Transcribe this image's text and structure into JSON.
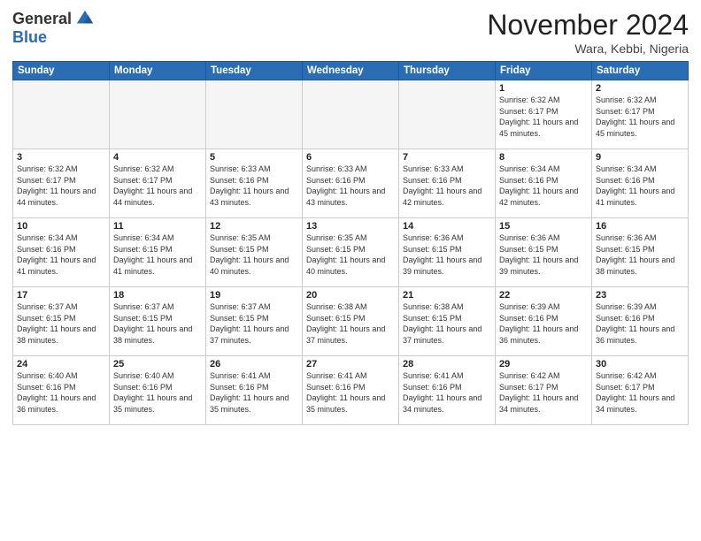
{
  "header": {
    "logo": {
      "general": "General",
      "blue": "Blue"
    },
    "title": "November 2024",
    "subtitle": "Wara, Kebbi, Nigeria"
  },
  "weekdays": [
    "Sunday",
    "Monday",
    "Tuesday",
    "Wednesday",
    "Thursday",
    "Friday",
    "Saturday"
  ],
  "weeks": [
    [
      {
        "day": "",
        "empty": true
      },
      {
        "day": "",
        "empty": true
      },
      {
        "day": "",
        "empty": true
      },
      {
        "day": "",
        "empty": true
      },
      {
        "day": "",
        "empty": true
      },
      {
        "day": "1",
        "sunrise": "Sunrise: 6:32 AM",
        "sunset": "Sunset: 6:17 PM",
        "daylight": "Daylight: 11 hours and 45 minutes."
      },
      {
        "day": "2",
        "sunrise": "Sunrise: 6:32 AM",
        "sunset": "Sunset: 6:17 PM",
        "daylight": "Daylight: 11 hours and 45 minutes."
      }
    ],
    [
      {
        "day": "3",
        "sunrise": "Sunrise: 6:32 AM",
        "sunset": "Sunset: 6:17 PM",
        "daylight": "Daylight: 11 hours and 44 minutes."
      },
      {
        "day": "4",
        "sunrise": "Sunrise: 6:32 AM",
        "sunset": "Sunset: 6:17 PM",
        "daylight": "Daylight: 11 hours and 44 minutes."
      },
      {
        "day": "5",
        "sunrise": "Sunrise: 6:33 AM",
        "sunset": "Sunset: 6:16 PM",
        "daylight": "Daylight: 11 hours and 43 minutes."
      },
      {
        "day": "6",
        "sunrise": "Sunrise: 6:33 AM",
        "sunset": "Sunset: 6:16 PM",
        "daylight": "Daylight: 11 hours and 43 minutes."
      },
      {
        "day": "7",
        "sunrise": "Sunrise: 6:33 AM",
        "sunset": "Sunset: 6:16 PM",
        "daylight": "Daylight: 11 hours and 42 minutes."
      },
      {
        "day": "8",
        "sunrise": "Sunrise: 6:34 AM",
        "sunset": "Sunset: 6:16 PM",
        "daylight": "Daylight: 11 hours and 42 minutes."
      },
      {
        "day": "9",
        "sunrise": "Sunrise: 6:34 AM",
        "sunset": "Sunset: 6:16 PM",
        "daylight": "Daylight: 11 hours and 41 minutes."
      }
    ],
    [
      {
        "day": "10",
        "sunrise": "Sunrise: 6:34 AM",
        "sunset": "Sunset: 6:16 PM",
        "daylight": "Daylight: 11 hours and 41 minutes."
      },
      {
        "day": "11",
        "sunrise": "Sunrise: 6:34 AM",
        "sunset": "Sunset: 6:15 PM",
        "daylight": "Daylight: 11 hours and 41 minutes."
      },
      {
        "day": "12",
        "sunrise": "Sunrise: 6:35 AM",
        "sunset": "Sunset: 6:15 PM",
        "daylight": "Daylight: 11 hours and 40 minutes."
      },
      {
        "day": "13",
        "sunrise": "Sunrise: 6:35 AM",
        "sunset": "Sunset: 6:15 PM",
        "daylight": "Daylight: 11 hours and 40 minutes."
      },
      {
        "day": "14",
        "sunrise": "Sunrise: 6:36 AM",
        "sunset": "Sunset: 6:15 PM",
        "daylight": "Daylight: 11 hours and 39 minutes."
      },
      {
        "day": "15",
        "sunrise": "Sunrise: 6:36 AM",
        "sunset": "Sunset: 6:15 PM",
        "daylight": "Daylight: 11 hours and 39 minutes."
      },
      {
        "day": "16",
        "sunrise": "Sunrise: 6:36 AM",
        "sunset": "Sunset: 6:15 PM",
        "daylight": "Daylight: 11 hours and 38 minutes."
      }
    ],
    [
      {
        "day": "17",
        "sunrise": "Sunrise: 6:37 AM",
        "sunset": "Sunset: 6:15 PM",
        "daylight": "Daylight: 11 hours and 38 minutes."
      },
      {
        "day": "18",
        "sunrise": "Sunrise: 6:37 AM",
        "sunset": "Sunset: 6:15 PM",
        "daylight": "Daylight: 11 hours and 38 minutes."
      },
      {
        "day": "19",
        "sunrise": "Sunrise: 6:37 AM",
        "sunset": "Sunset: 6:15 PM",
        "daylight": "Daylight: 11 hours and 37 minutes."
      },
      {
        "day": "20",
        "sunrise": "Sunrise: 6:38 AM",
        "sunset": "Sunset: 6:15 PM",
        "daylight": "Daylight: 11 hours and 37 minutes."
      },
      {
        "day": "21",
        "sunrise": "Sunrise: 6:38 AM",
        "sunset": "Sunset: 6:15 PM",
        "daylight": "Daylight: 11 hours and 37 minutes."
      },
      {
        "day": "22",
        "sunrise": "Sunrise: 6:39 AM",
        "sunset": "Sunset: 6:16 PM",
        "daylight": "Daylight: 11 hours and 36 minutes."
      },
      {
        "day": "23",
        "sunrise": "Sunrise: 6:39 AM",
        "sunset": "Sunset: 6:16 PM",
        "daylight": "Daylight: 11 hours and 36 minutes."
      }
    ],
    [
      {
        "day": "24",
        "sunrise": "Sunrise: 6:40 AM",
        "sunset": "Sunset: 6:16 PM",
        "daylight": "Daylight: 11 hours and 36 minutes."
      },
      {
        "day": "25",
        "sunrise": "Sunrise: 6:40 AM",
        "sunset": "Sunset: 6:16 PM",
        "daylight": "Daylight: 11 hours and 35 minutes."
      },
      {
        "day": "26",
        "sunrise": "Sunrise: 6:41 AM",
        "sunset": "Sunset: 6:16 PM",
        "daylight": "Daylight: 11 hours and 35 minutes."
      },
      {
        "day": "27",
        "sunrise": "Sunrise: 6:41 AM",
        "sunset": "Sunset: 6:16 PM",
        "daylight": "Daylight: 11 hours and 35 minutes."
      },
      {
        "day": "28",
        "sunrise": "Sunrise: 6:41 AM",
        "sunset": "Sunset: 6:16 PM",
        "daylight": "Daylight: 11 hours and 34 minutes."
      },
      {
        "day": "29",
        "sunrise": "Sunrise: 6:42 AM",
        "sunset": "Sunset: 6:17 PM",
        "daylight": "Daylight: 11 hours and 34 minutes."
      },
      {
        "day": "30",
        "sunrise": "Sunrise: 6:42 AM",
        "sunset": "Sunset: 6:17 PM",
        "daylight": "Daylight: 11 hours and 34 minutes."
      }
    ]
  ]
}
